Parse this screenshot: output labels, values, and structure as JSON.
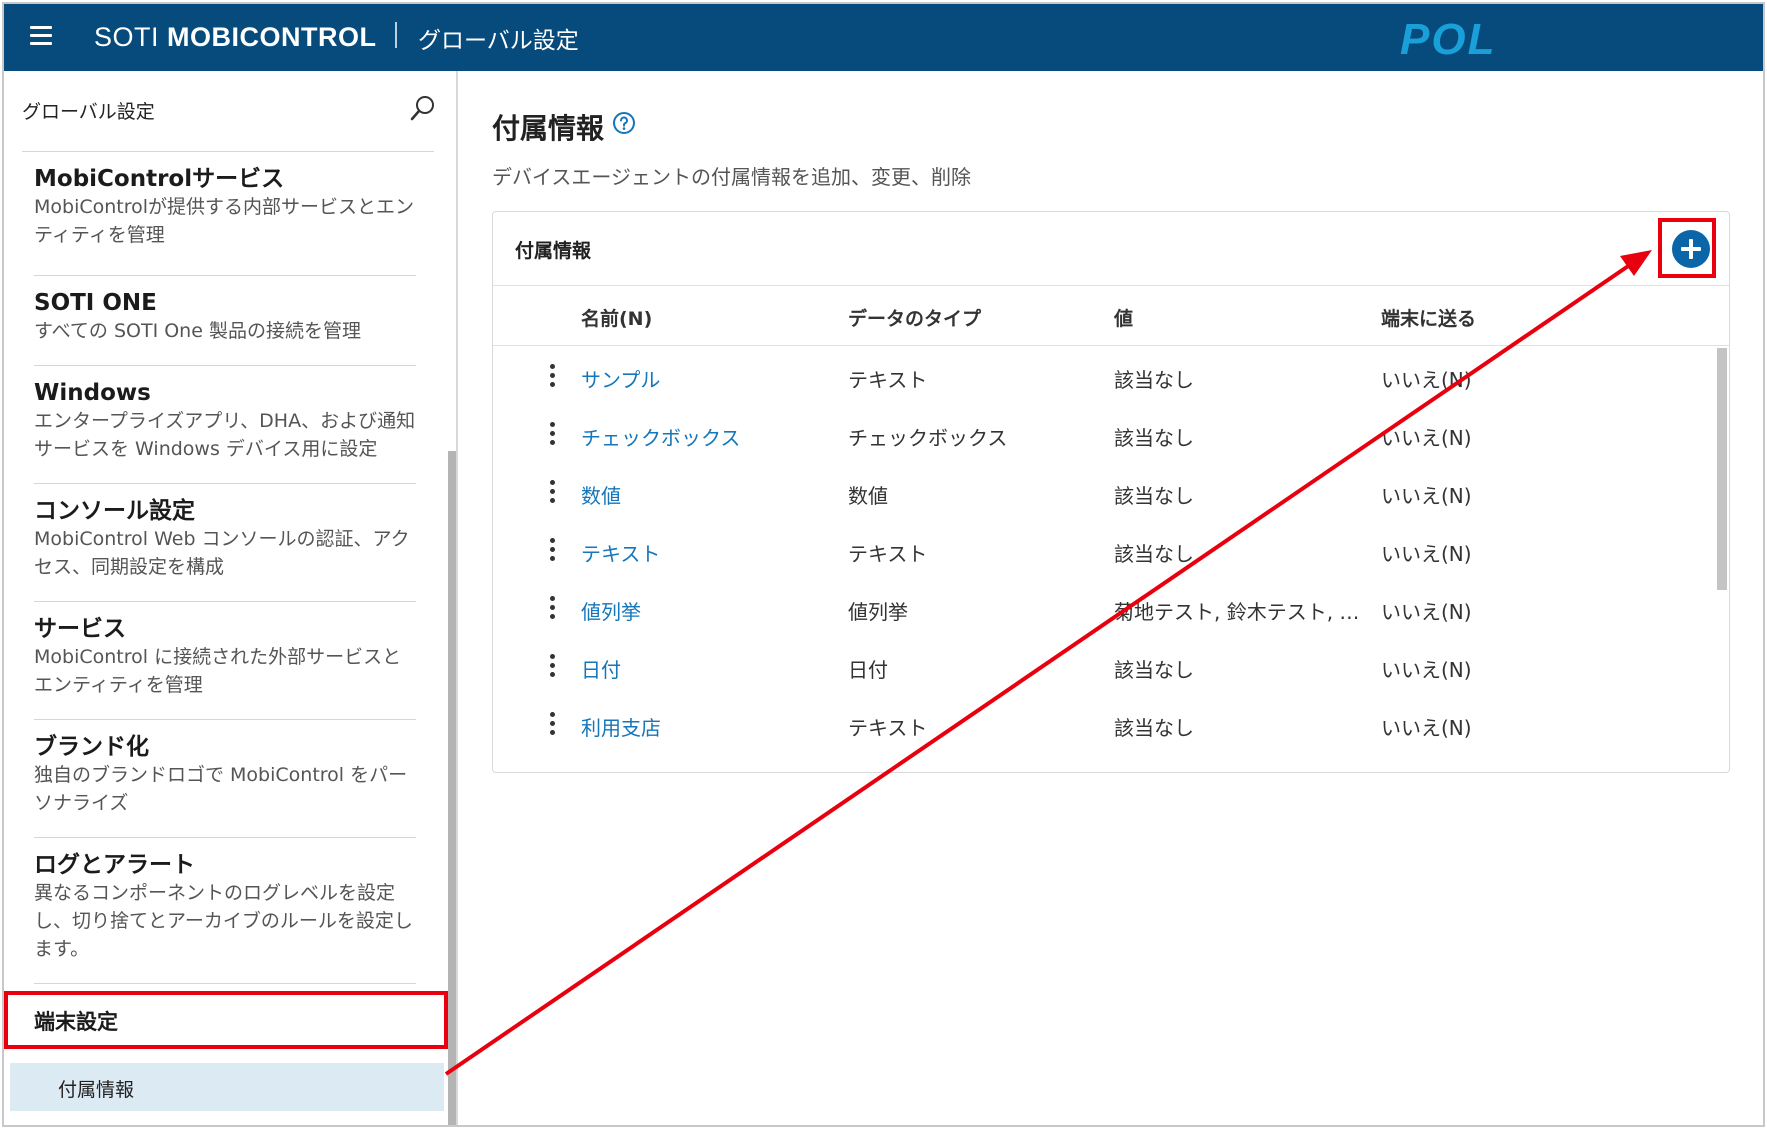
{
  "header": {
    "brand_light": "SOTI ",
    "brand_bold": "MOBICONTROL",
    "page": "グローバル設定",
    "logo_text": "POL",
    "colors": {
      "bar": "#074b7d",
      "logo": "#1aa0d8"
    }
  },
  "sidebar": {
    "search_label": "グローバル設定",
    "items": [
      {
        "title": "MobiControlサービス",
        "desc": "MobiControlが提供する内部サービスとエンティティを管理"
      },
      {
        "title": "SOTI ONE",
        "desc": "すべての SOTI One 製品の接続を管理"
      },
      {
        "title": "Windows",
        "desc": "エンタープライズアプリ、DHA、および通知サービスを Windows デバイス用に設定"
      },
      {
        "title": "コンソール設定",
        "desc": "MobiControl Web コンソールの認証、アクセス、同期設定を構成"
      },
      {
        "title": "サービス",
        "desc": "MobiControl に接続された外部サービスとエンティティを管理"
      },
      {
        "title": "ブランド化",
        "desc": "独自のブランドロゴで MobiControl をパーソナライズ"
      },
      {
        "title": "ログとアラート",
        "desc": "異なるコンポーネントのログレベルを設定し、切り捨てとアーカイブのルールを設定します。"
      }
    ],
    "group_label": "端末設定",
    "active_item": "付属情報"
  },
  "main": {
    "title": "付属情報",
    "description": "デバイスエージェントの付属情報を追加、変更、削除",
    "card_title": "付属情報",
    "columns": [
      "名前(N)",
      "データのタイプ",
      "値",
      "端末に送る"
    ],
    "rows": [
      {
        "name": "サンプル",
        "type": "テキスト",
        "value": "該当なし",
        "send": "いいえ(N)"
      },
      {
        "name": "チェックボックス",
        "type": "チェックボックス",
        "value": "該当なし",
        "send": "いいえ(N)"
      },
      {
        "name": "数値",
        "type": "数値",
        "value": "該当なし",
        "send": "いいえ(N)"
      },
      {
        "name": "テキスト",
        "type": "テキスト",
        "value": "該当なし",
        "send": "いいえ(N)"
      },
      {
        "name": "値列挙",
        "type": "値列挙",
        "value": "菊地テスト, 鈴木テスト, …",
        "send": "いいえ(N)"
      },
      {
        "name": "日付",
        "type": "日付",
        "value": "該当なし",
        "send": "いいえ(N)"
      },
      {
        "name": "利用支店",
        "type": "テキスト",
        "value": "該当なし",
        "send": "いいえ(N)"
      }
    ],
    "accent": "#1576b9",
    "annotation_color": "#e8000f"
  }
}
